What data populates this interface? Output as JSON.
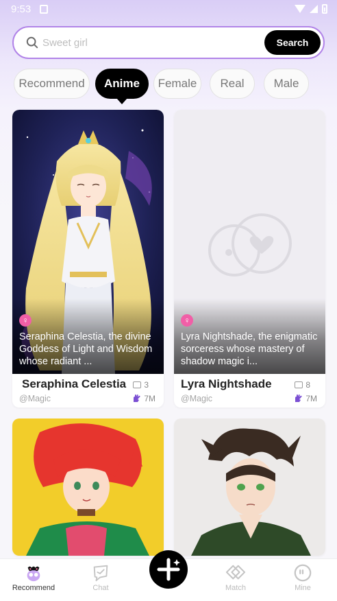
{
  "status_bar": {
    "time": "9:53"
  },
  "search": {
    "placeholder": "Sweet girl",
    "value": "",
    "button_label": "Search"
  },
  "tabs": [
    {
      "label": "Recommend",
      "active": false
    },
    {
      "label": "Anime",
      "active": true
    },
    {
      "label": "Female",
      "active": false
    },
    {
      "label": "Real",
      "active": false
    },
    {
      "label": "Male",
      "active": false
    }
  ],
  "cards": [
    {
      "name": "Seraphina Celestia",
      "author": "@Magic",
      "description": "Seraphina Celestia, the divine Goddess of Light and Wisdom whose radiant ...",
      "photos": "3",
      "likes": "7M",
      "gender_icon": "female-icon"
    },
    {
      "name": "Lyra Nightshade",
      "author": "@Magic",
      "description": "Lyra Nightshade, the enigmatic sorceress whose mastery of shadow magic i...",
      "photos": "8",
      "likes": "7M",
      "gender_icon": "female-icon"
    }
  ],
  "bottom_nav": [
    {
      "label": "Recommend",
      "icon": "mascot-icon",
      "active": true
    },
    {
      "label": "Chat",
      "icon": "chat-icon",
      "active": false
    },
    {
      "label": "Match",
      "icon": "match-icon",
      "active": false
    },
    {
      "label": "Mine",
      "icon": "mine-icon",
      "active": false
    }
  ],
  "colors": {
    "accent": "#b183e8",
    "female_badge": "#f15fa7",
    "likes_icon": "#7b4fd3"
  }
}
